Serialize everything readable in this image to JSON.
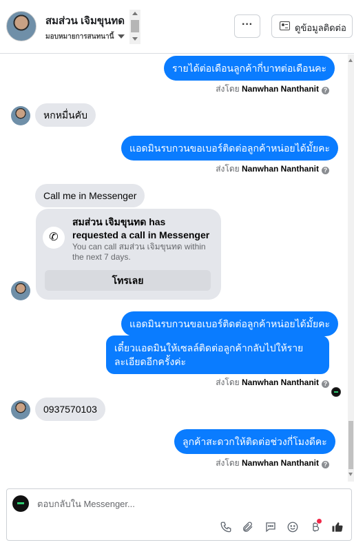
{
  "header": {
    "contact_name": "สมส่วน เจิมขุนทด",
    "assign_label": "มอบหมายการสนทนานี้",
    "more_label": "···",
    "info_button_label": "ดูข้อมูลติดต่อ"
  },
  "messages": {
    "m1": "รายได้ต่อเดือนลูกค้ากี่บาทต่อเดือนคะ",
    "m2": "หกหมื่นคับ",
    "m3": "แอดมินรบกวนขอเบอร์ติดต่อลูกค้าหน่อยได้มั้ยคะ",
    "m4": "Call me in Messenger",
    "m5": "แอดมินรบกวนขอเบอร์ติดต่อลูกค้าหน่อยได้มั้ยคะ",
    "m6_line1": "เดี๋ยวแอดมินให้เซลล์ติดต่อลูกค้ากลับไปให้ราย",
    "m6_line2": "ละเอียดอีกครั้งค่ะ",
    "m7": "0937570103",
    "m8": "ลูกค้าสะดวกให้ติดต่อช่วงกี่โมงดีคะ"
  },
  "sent_by": {
    "prefix": "ส่งโดย",
    "name": "Nanwhan Nanthanit",
    "help": "?"
  },
  "call_request": {
    "title": "สมส่วน เจิมขุนทด has requested a call in Messenger",
    "subtitle": "You can call สมส่วน เจิมขุนทด within the next 7 days.",
    "button": "โทรเลย"
  },
  "composer": {
    "placeholder": "ตอบกลับใน Messenger..."
  }
}
